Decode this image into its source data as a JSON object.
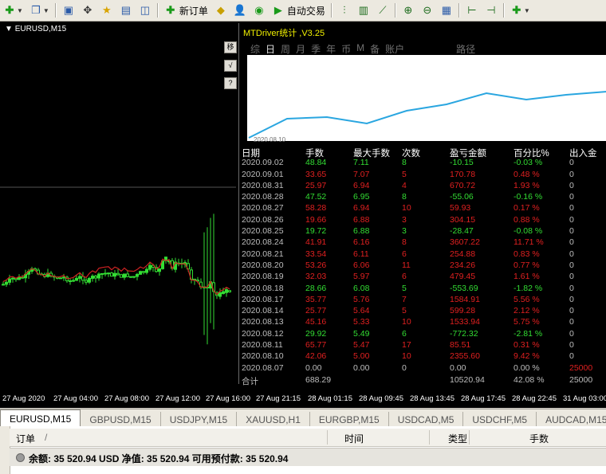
{
  "toolbar": {
    "new_order": "新订单",
    "auto_trading": "自动交易"
  },
  "chart": {
    "title": "EURUSD,M15",
    "side_buttons": [
      "移",
      "√",
      "?"
    ],
    "time_ticks": [
      "27 Aug 2020",
      "27 Aug 04:00",
      "27 Aug 08:00",
      "27 Aug 12:00",
      "27 Aug 16:00",
      "27 Aug 21:15",
      "28 Aug 01:15",
      "28 Aug 09:45",
      "28 Aug 13:45",
      "28 Aug 17:45",
      "28 Aug 22:45",
      "31 Aug 03:00"
    ],
    "colors": {
      "bull_candle": "#33dd33",
      "moving_average": "#cc2222",
      "background": "#000000"
    }
  },
  "panel": {
    "title": "MTDriver统计 ,V3.25",
    "tabs": [
      "综",
      "日",
      "周",
      "月",
      "季",
      "年",
      "币",
      "M",
      "备",
      "账户",
      "路径"
    ],
    "active_tab": "日",
    "line_chart_label": "2020.08.10",
    "line_color": "#2aa6e0",
    "headers": [
      "日期",
      "手数",
      "最大手数",
      "次数",
      "盈亏金额",
      "百分比%",
      "出入金"
    ],
    "rows": [
      {
        "date": "2020.09.02",
        "lots": "48.84",
        "max": "7.11",
        "count": "8",
        "pl": "-10.15",
        "pct": "-0.03 %",
        "io": "0",
        "c": "green"
      },
      {
        "date": "2020.09.01",
        "lots": "33.65",
        "max": "7.07",
        "count": "5",
        "pl": "170.78",
        "pct": "0.48 %",
        "io": "0",
        "c": "red"
      },
      {
        "date": "2020.08.31",
        "lots": "25.97",
        "max": "6.94",
        "count": "4",
        "pl": "670.72",
        "pct": "1.93 %",
        "io": "0",
        "c": "red"
      },
      {
        "date": "2020.08.28",
        "lots": "47.52",
        "max": "6.95",
        "count": "8",
        "pl": "-55.06",
        "pct": "-0.16 %",
        "io": "0",
        "c": "green"
      },
      {
        "date": "2020.08.27",
        "lots": "58.28",
        "max": "6.94",
        "count": "10",
        "pl": "59.93",
        "pct": "0.17 %",
        "io": "0",
        "c": "red"
      },
      {
        "date": "2020.08.26",
        "lots": "19.66",
        "max": "6.88",
        "count": "3",
        "pl": "304.15",
        "pct": "0.88 %",
        "io": "0",
        "c": "red"
      },
      {
        "date": "2020.08.25",
        "lots": "19.72",
        "max": "6.88",
        "count": "3",
        "pl": "-28.47",
        "pct": "-0.08 %",
        "io": "0",
        "c": "green"
      },
      {
        "date": "2020.08.24",
        "lots": "41.91",
        "max": "6.16",
        "count": "8",
        "pl": "3607.22",
        "pct": "11.71 %",
        "io": "0",
        "c": "red"
      },
      {
        "date": "2020.08.21",
        "lots": "33.54",
        "max": "6.11",
        "count": "6",
        "pl": "254.88",
        "pct": "0.83 %",
        "io": "0",
        "c": "red"
      },
      {
        "date": "2020.08.20",
        "lots": "53.26",
        "max": "6.06",
        "count": "11",
        "pl": "234.26",
        "pct": "0.77 %",
        "io": "0",
        "c": "red"
      },
      {
        "date": "2020.08.19",
        "lots": "32.03",
        "max": "5.97",
        "count": "6",
        "pl": "479.45",
        "pct": "1.61 %",
        "io": "0",
        "c": "red"
      },
      {
        "date": "2020.08.18",
        "lots": "28.66",
        "max": "6.08",
        "count": "5",
        "pl": "-553.69",
        "pct": "-1.82 %",
        "io": "0",
        "c": "green"
      },
      {
        "date": "2020.08.17",
        "lots": "35.77",
        "max": "5.76",
        "count": "7",
        "pl": "1584.91",
        "pct": "5.56 %",
        "io": "0",
        "c": "red"
      },
      {
        "date": "2020.08.14",
        "lots": "25.77",
        "max": "5.64",
        "count": "5",
        "pl": "599.28",
        "pct": "2.12 %",
        "io": "0",
        "c": "red"
      },
      {
        "date": "2020.08.13",
        "lots": "45.16",
        "max": "5.33",
        "count": "10",
        "pl": "1533.94",
        "pct": "5.75 %",
        "io": "0",
        "c": "red"
      },
      {
        "date": "2020.08.12",
        "lots": "29.92",
        "max": "5.49",
        "count": "6",
        "pl": "-772.32",
        "pct": "-2.81 %",
        "io": "0",
        "c": "green"
      },
      {
        "date": "2020.08.11",
        "lots": "65.77",
        "max": "5.47",
        "count": "17",
        "pl": "85.51",
        "pct": "0.31 %",
        "io": "0",
        "c": "red"
      },
      {
        "date": "2020.08.10",
        "lots": "42.06",
        "max": "5.00",
        "count": "10",
        "pl": "2355.60",
        "pct": "9.42 %",
        "io": "0",
        "c": "red"
      },
      {
        "date": "2020.08.07",
        "lots": "0.00",
        "max": "0.00",
        "count": "0",
        "pl": "0.00",
        "pct": "0.00 %",
        "io": "25000",
        "c": "grey"
      }
    ],
    "total": {
      "label": "合计",
      "lots": "688.29",
      "pl": "10520.94",
      "pct": "42.08 %",
      "io": "25000"
    }
  },
  "symbol_tabs": [
    "EURUSD,M15",
    "GBPUSD,M15",
    "USDJPY,M15",
    "XAUUSD,H1",
    "EURGBP,M15",
    "USDCAD,M5",
    "USDCHF,M5",
    "AUDCAD,M15"
  ],
  "terminal": {
    "col_order": "订单",
    "col_sort": "/",
    "col_time": "时间",
    "col_type": "类型",
    "col_lots": "手数",
    "balance_line": "余额: 35 520.94 USD  净值: 35 520.94  可用预付款: 35 520.94"
  }
}
